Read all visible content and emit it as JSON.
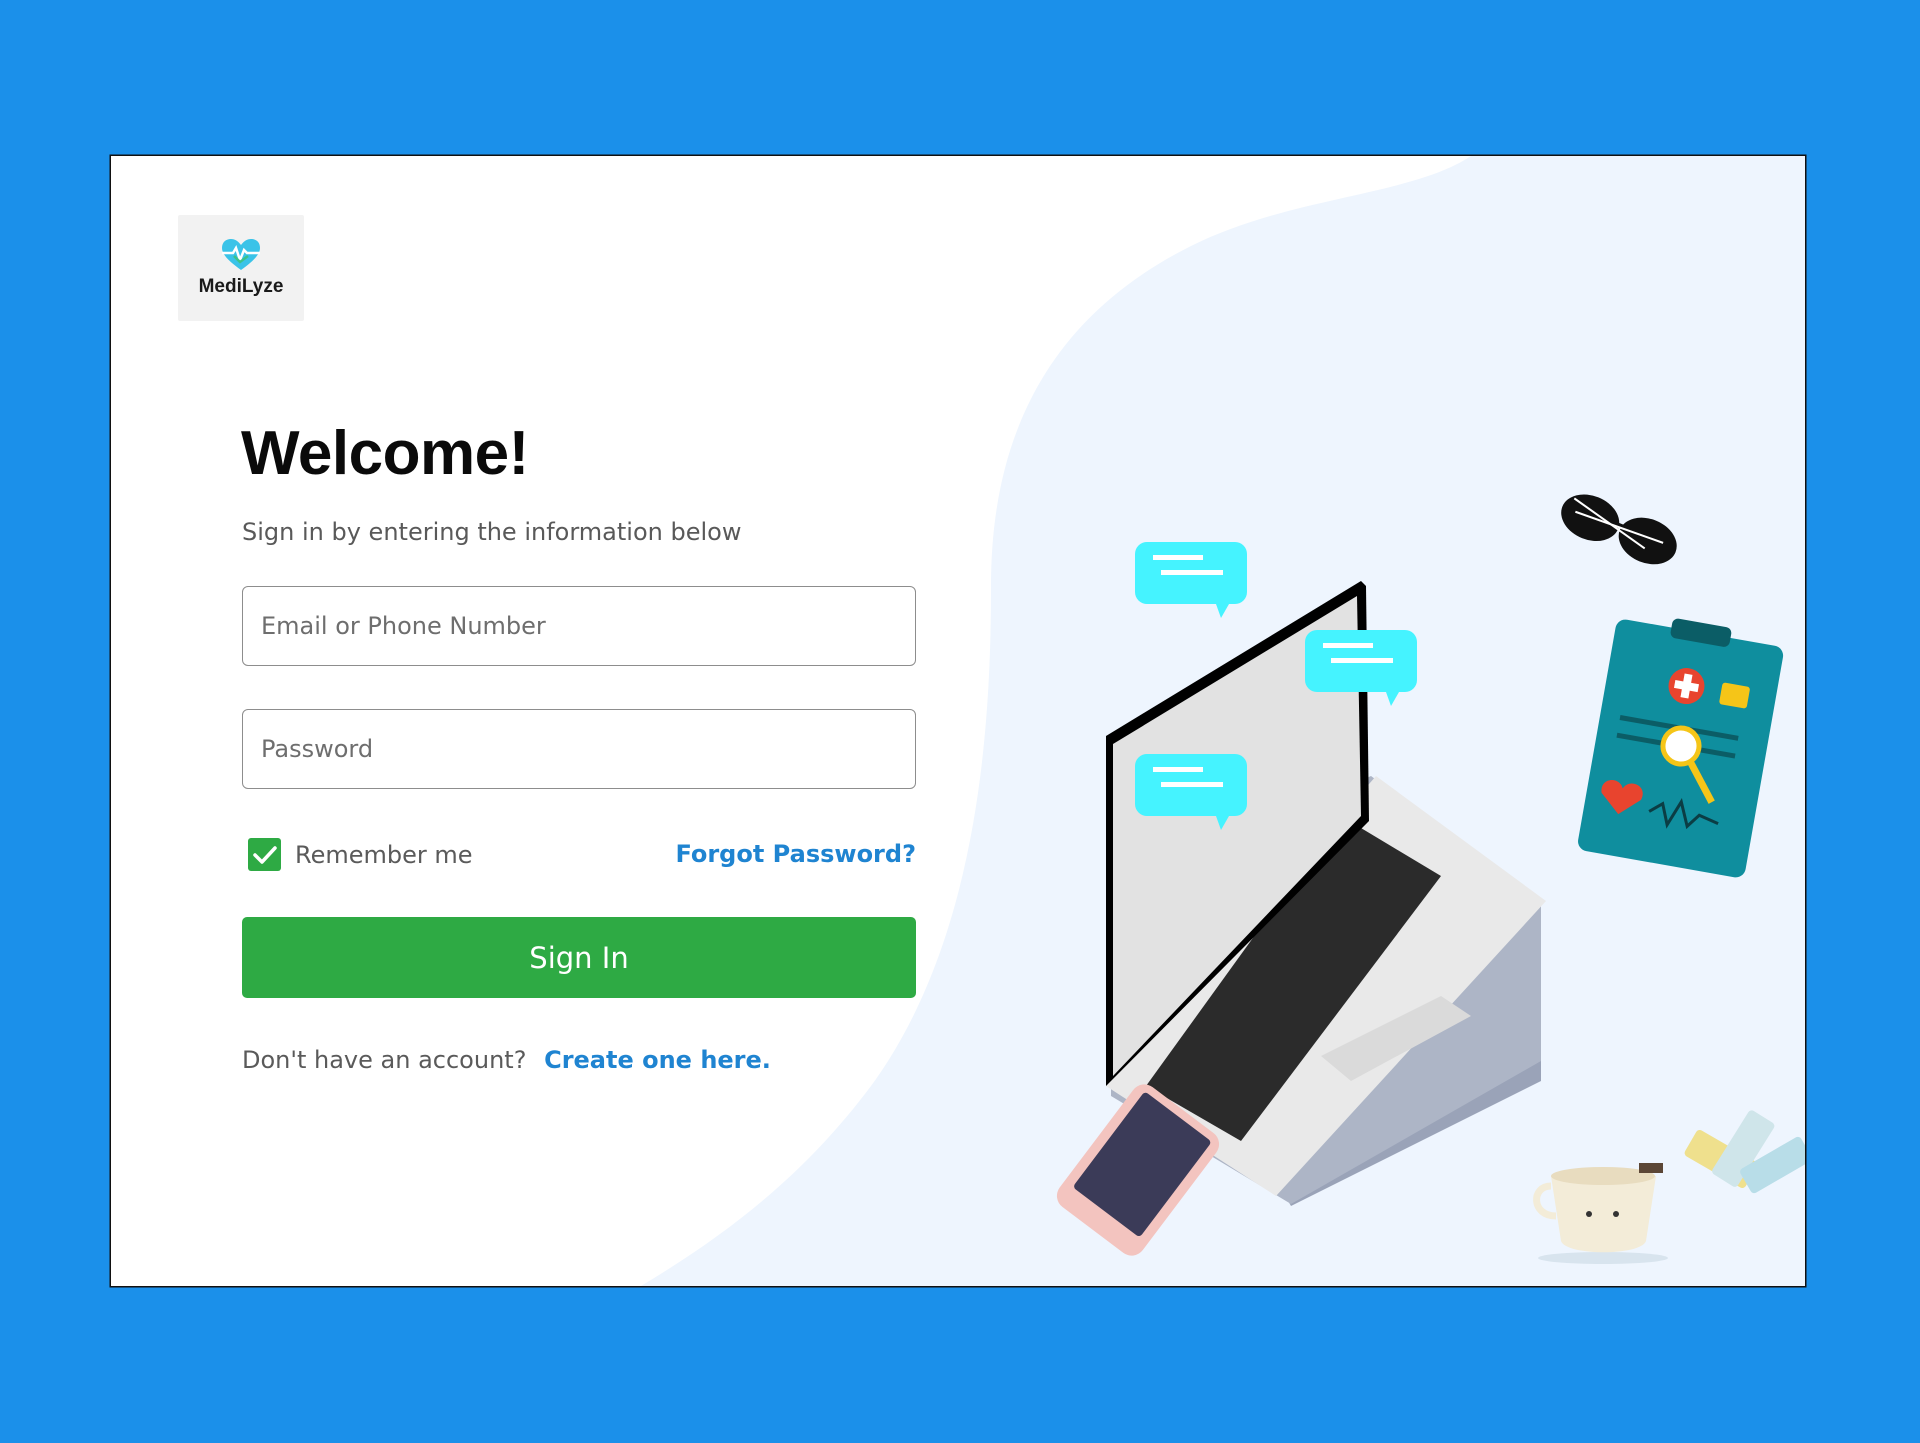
{
  "brand": {
    "name": "MediLyze"
  },
  "heading": "Welcome!",
  "subtitle": "Sign in by entering the information below",
  "form": {
    "email_placeholder": "Email or Phone Number",
    "password_placeholder": "Password",
    "remember_label": "Remember me",
    "remember_checked": true,
    "forgot_label": "Forgot Password?",
    "submit_label": "Sign In"
  },
  "footer": {
    "prompt": "Don't have an account?",
    "link_label": "Create one here."
  },
  "colors": {
    "page_background": "#1b90ea",
    "accent_green": "#2eaa44",
    "link_blue": "#1f84d1",
    "illustration_background": "#eef5fe"
  },
  "icons": [
    "heart-pulse-icon",
    "checkmark-icon",
    "laptop-illustration",
    "chat-bubble-illustration",
    "sunglasses-illustration",
    "clipboard-illustration",
    "phone-illustration",
    "coffee-cup-illustration",
    "pills-illustration"
  ]
}
